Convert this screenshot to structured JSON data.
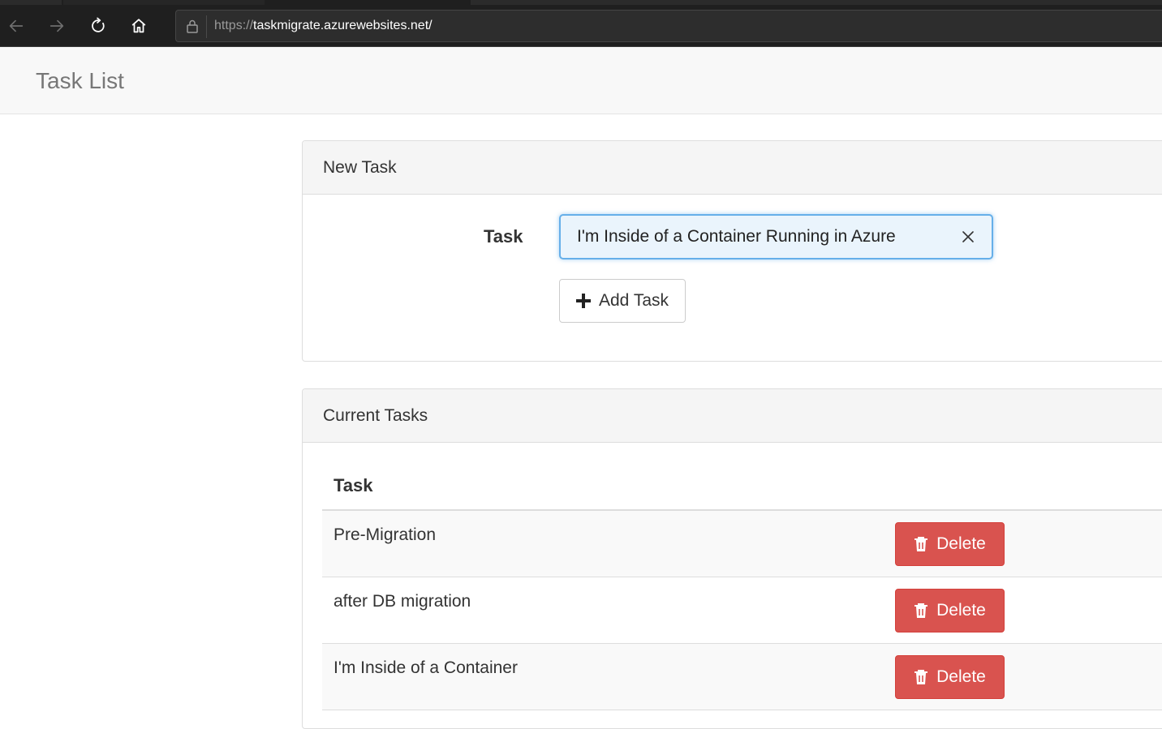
{
  "browser": {
    "url_scheme": "https://",
    "url_host": "taskmigrate.azurewebsites.net/",
    "icons": [
      "back-icon",
      "forward-icon",
      "refresh-icon",
      "home-icon",
      "lock-icon"
    ]
  },
  "header": {
    "title": "Task List"
  },
  "new_task": {
    "heading": "New Task",
    "label": "Task",
    "input_value": "I'm Inside of a Container Running in Azure",
    "add_label": "Add Task",
    "focus_color": "#66afe9"
  },
  "current_tasks": {
    "heading": "Current Tasks",
    "column_header": "Task",
    "rows": [
      {
        "task": "Pre-Migration",
        "action": "Delete"
      },
      {
        "task": "after DB migration",
        "action": "Delete"
      },
      {
        "task": "I'm Inside of a Container",
        "action": "Delete"
      }
    ],
    "delete_color": "#d9534f"
  }
}
